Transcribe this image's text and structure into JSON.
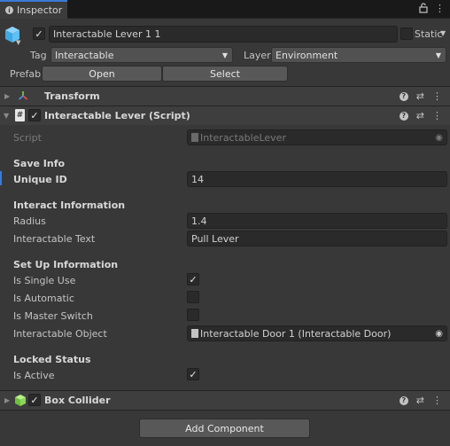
{
  "tab": {
    "label": "Inspector"
  },
  "object": {
    "name": "Interactable Lever 1 1",
    "static_label": "Static",
    "active": true,
    "static": false
  },
  "tag": {
    "label": "Tag",
    "value": "Interactable"
  },
  "layer": {
    "label": "Layer",
    "value": "Environment"
  },
  "prefab": {
    "label": "Prefab",
    "open": "Open",
    "select": "Select"
  },
  "transform": {
    "title": "Transform"
  },
  "script_comp": {
    "title": "Interactable Lever (Script)",
    "enabled": true,
    "script_label": "Script",
    "script_value": "InteractableLever"
  },
  "save_info": {
    "header": "Save Info",
    "unique_id_label": "Unique ID",
    "unique_id": "14"
  },
  "interact_info": {
    "header": "Interact Information",
    "radius_label": "Radius",
    "radius": "1.4",
    "text_label": "Interactable Text",
    "text": "Pull Lever"
  },
  "setup_info": {
    "header": "Set Up Information",
    "single_use_label": "Is Single Use",
    "single_use": true,
    "automatic_label": "Is Automatic",
    "automatic": false,
    "master_label": "Is Master Switch",
    "master": false,
    "object_label": "Interactable Object",
    "object_value": "Interactable Door 1 (Interactable Door)"
  },
  "locked": {
    "header": "Locked Status",
    "active_label": "Is Active",
    "active": true
  },
  "box_collider": {
    "title": "Box Collider",
    "enabled": true
  },
  "add_component": "Add Component",
  "colors": {
    "accent": "#3a7bd5",
    "background": "#383838",
    "field": "#2a2a2a"
  }
}
